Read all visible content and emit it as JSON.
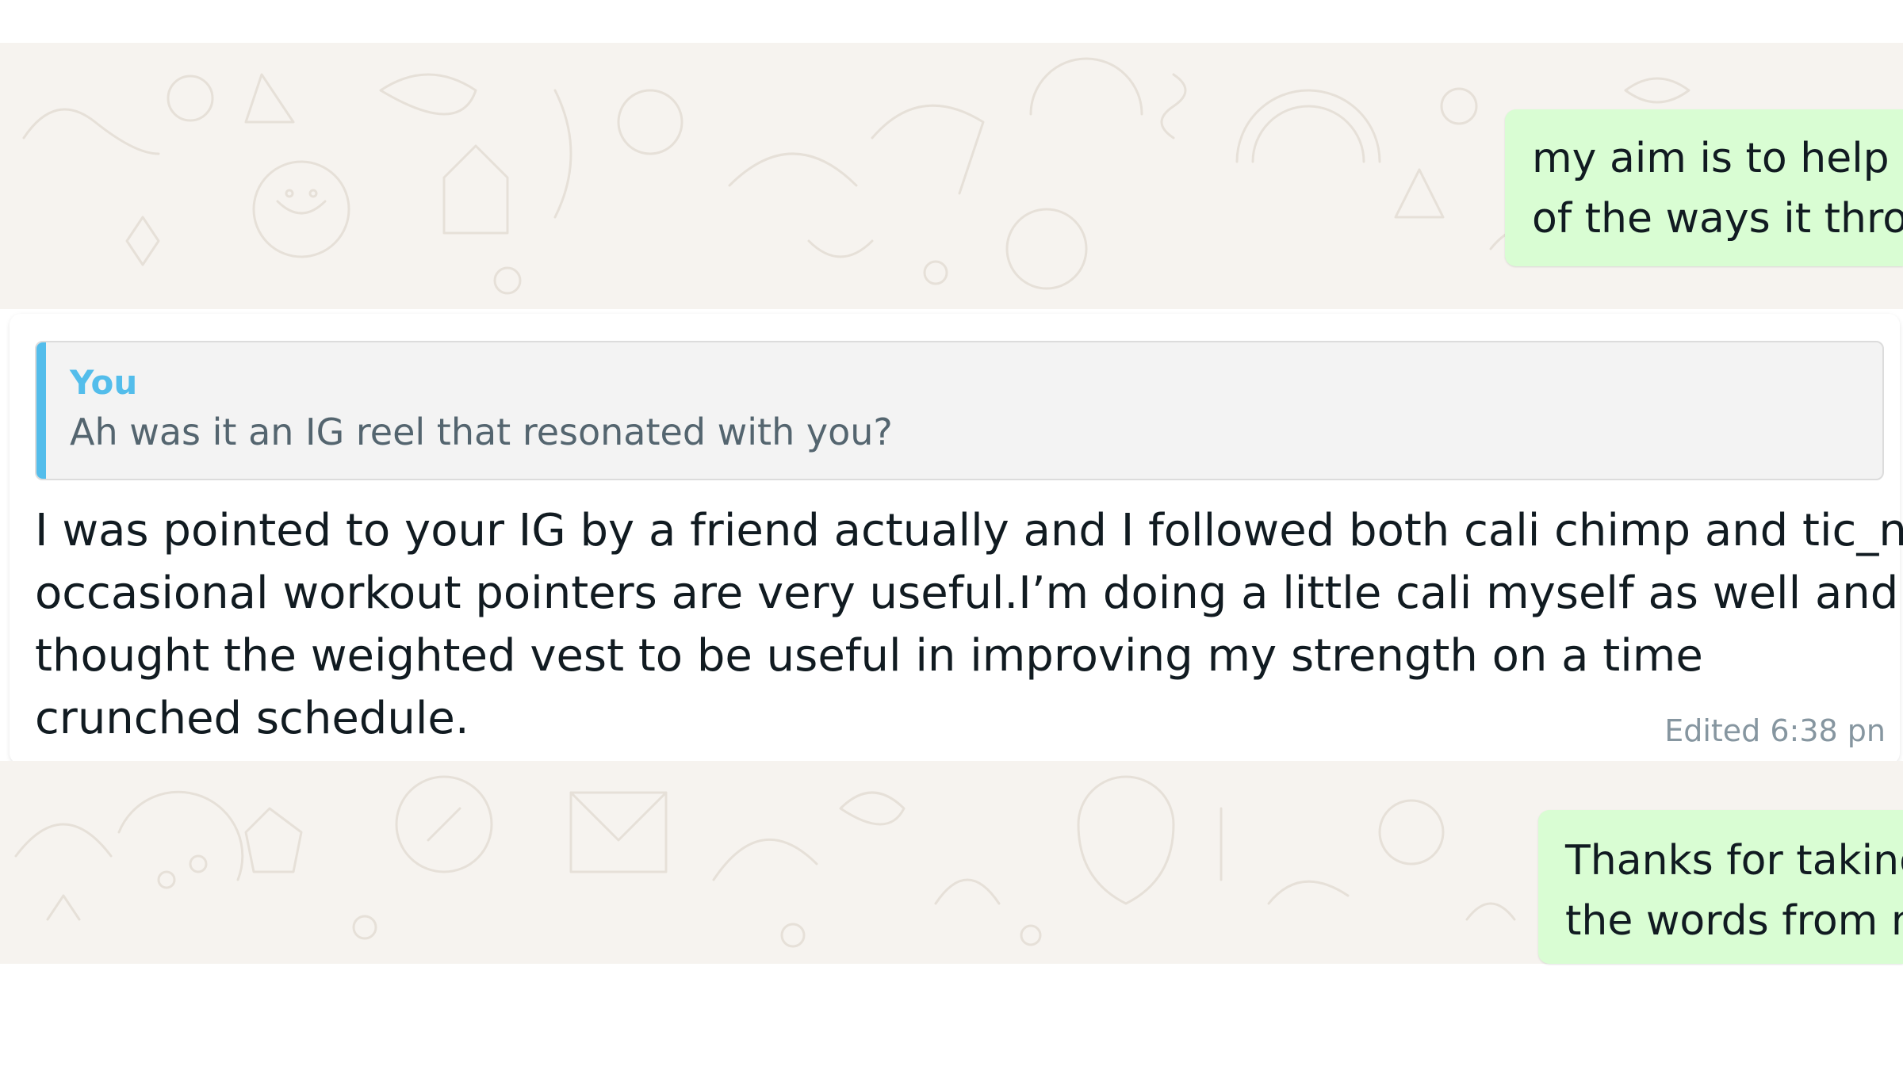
{
  "chat": {
    "outgoing_top": {
      "lines": [
        "my aim is to help p",
        "of the ways it thro"
      ]
    },
    "incoming_highlighted": {
      "quoted": {
        "author": "You",
        "text": "Ah was it an IG reel that resonated with you?"
      },
      "lines": [
        "I was pointed to your IG by a friend actually and I followed both cali chimp and tic_nic.The",
        "occasional workout pointers are very useful.I’m doing a little cali myself as well and",
        "thought the weighted vest to be useful in improving my strength on a time",
        "crunched schedule."
      ],
      "meta": "Edited 6:38 pn"
    },
    "outgoing_bottom": {
      "lines": [
        "Thanks for taking",
        "the words from m"
      ]
    }
  },
  "colors": {
    "wallpaper": "#f6f3ef",
    "outgoing_bubble": "#d9fdd3",
    "quote_accent": "#53bdeb",
    "text_primary": "#111b21",
    "text_meta": "#8696a0"
  }
}
